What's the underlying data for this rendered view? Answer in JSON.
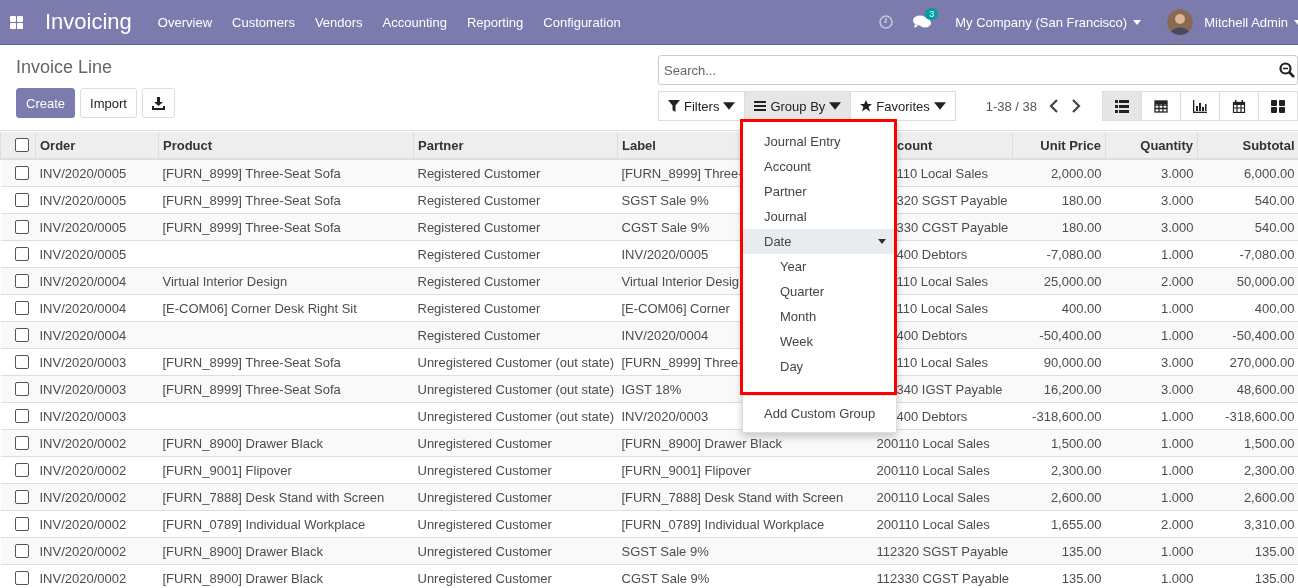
{
  "navbar": {
    "app_title": "Invoicing",
    "menu": [
      "Overview",
      "Customers",
      "Vendors",
      "Accounting",
      "Reporting",
      "Configuration"
    ],
    "messages_badge": "3",
    "company": "My Company (San Francisco)",
    "user": "Mitchell Admin"
  },
  "control_panel": {
    "title": "Invoice Line",
    "buttons": [
      "Create",
      "Import"
    ],
    "search": {
      "placeholder": "Search..."
    },
    "search_buttons": [
      {
        "label": "Filters",
        "kind": "filter",
        "selected": false
      },
      {
        "label": "Group By",
        "kind": "group",
        "selected": true
      },
      {
        "label": "Favorites",
        "kind": "star",
        "selected": false
      }
    ],
    "pager": "1-38 / 38",
    "views": [
      {
        "kind": "list",
        "selected": true
      },
      {
        "kind": "pivot",
        "selected": false
      },
      {
        "kind": "graph",
        "selected": false
      },
      {
        "kind": "calendar",
        "selected": false
      },
      {
        "kind": "kanban",
        "selected": false
      }
    ]
  },
  "group_by_menu": {
    "options": [
      {
        "label": "Journal Entry"
      },
      {
        "label": "Account"
      },
      {
        "label": "Partner"
      },
      {
        "label": "Journal"
      },
      {
        "label": "Date",
        "expanded": true,
        "children": [
          {
            "label": "Year"
          },
          {
            "label": "Quarter"
          },
          {
            "label": "Month"
          },
          {
            "label": "Week"
          },
          {
            "label": "Day"
          }
        ]
      }
    ],
    "custom": "Add Custom Group"
  },
  "table": {
    "all_checked": false,
    "columns": [
      "Order",
      "Product",
      "Partner",
      "Label",
      "count",
      "Unit Price",
      "Quantity",
      "Subtotal"
    ],
    "rows": [
      {
        "checked": false,
        "under_menu": true,
        "cells": [
          "INV/2020/0005",
          "[FURN_8999] Three-Seat Sofa",
          "Registered Customer",
          "[FURN_8999] Three-",
          "110 Local Sales",
          "2,000.00",
          "3.000",
          "6,000.00"
        ]
      },
      {
        "checked": false,
        "under_menu": true,
        "cells": [
          "INV/2020/0005",
          "[FURN_8999] Three-Seat Sofa",
          "Registered Customer",
          "SGST Sale 9%",
          "320 SGST Payable",
          "180.00",
          "3.000",
          "540.00"
        ]
      },
      {
        "checked": false,
        "under_menu": true,
        "cells": [
          "INV/2020/0005",
          "[FURN_8999] Three-Seat Sofa",
          "Registered Customer",
          "CGST Sale 9%",
          "330 CGST Payable",
          "180.00",
          "3.000",
          "540.00"
        ]
      },
      {
        "checked": false,
        "under_menu": true,
        "cells": [
          "INV/2020/0005",
          "",
          "Registered Customer",
          "INV/2020/0005",
          "400 Debtors",
          "-7,080.00",
          "1.000",
          "-7,080.00"
        ]
      },
      {
        "checked": false,
        "under_menu": true,
        "cells": [
          "INV/2020/0004",
          "Virtual Interior Design",
          "Registered Customer",
          "Virtual Interior Desig",
          "110 Local Sales",
          "25,000.00",
          "2.000",
          "50,000.00"
        ]
      },
      {
        "checked": false,
        "under_menu": true,
        "cells": [
          "INV/2020/0004",
          "[E-COM06] Corner Desk Right Sit",
          "Registered Customer",
          "[E-COM06] Corner",
          "110 Local Sales",
          "400.00",
          "1.000",
          "400.00"
        ]
      },
      {
        "checked": false,
        "under_menu": true,
        "cells": [
          "INV/2020/0004",
          "",
          "Registered Customer",
          "INV/2020/0004",
          "400 Debtors",
          "-50,400.00",
          "1.000",
          "-50,400.00"
        ]
      },
      {
        "checked": false,
        "under_menu": true,
        "cells": [
          "INV/2020/0003",
          "[FURN_8999] Three-Seat Sofa",
          "Unregistered Customer (out state)",
          "[FURN_8999] Three-",
          "110 Local Sales",
          "90,000.00",
          "3.000",
          "270,000.00"
        ]
      },
      {
        "checked": false,
        "under_menu": true,
        "cells": [
          "INV/2020/0003",
          "[FURN_8999] Three-Seat Sofa",
          "Unregistered Customer (out state)",
          "IGST 18%",
          "340 IGST Payable",
          "16,200.00",
          "3.000",
          "48,600.00"
        ]
      },
      {
        "checked": false,
        "under_menu": true,
        "cells": [
          "INV/2020/0003",
          "",
          "Unregistered Customer (out state)",
          "INV/2020/0003",
          "400 Debtors",
          "-318,600.00",
          "1.000",
          "-318,600.00"
        ]
      },
      {
        "checked": false,
        "under_menu": false,
        "cells": [
          "INV/2020/0002",
          "[FURN_8900] Drawer Black",
          "Unregistered Customer",
          "[FURN_8900] Drawer Black",
          "200110 Local Sales",
          "1,500.00",
          "1.000",
          "1,500.00"
        ]
      },
      {
        "checked": false,
        "under_menu": false,
        "cells": [
          "INV/2020/0002",
          "[FURN_9001] Flipover",
          "Unregistered Customer",
          "[FURN_9001] Flipover",
          "200110 Local Sales",
          "2,300.00",
          "1.000",
          "2,300.00"
        ]
      },
      {
        "checked": false,
        "under_menu": false,
        "cells": [
          "INV/2020/0002",
          "[FURN_7888] Desk Stand with Screen",
          "Unregistered Customer",
          "[FURN_7888] Desk Stand with Screen",
          "200110 Local Sales",
          "2,600.00",
          "1.000",
          "2,600.00"
        ]
      },
      {
        "checked": false,
        "under_menu": false,
        "cells": [
          "INV/2020/0002",
          "[FURN_0789] Individual Workplace",
          "Unregistered Customer",
          "[FURN_0789] Individual Workplace",
          "200110 Local Sales",
          "1,655.00",
          "2.000",
          "3,310.00"
        ]
      },
      {
        "checked": false,
        "under_menu": false,
        "cells": [
          "INV/2020/0002",
          "[FURN_8900] Drawer Black",
          "Unregistered Customer",
          "SGST Sale 9%",
          "112320 SGST Payable",
          "135.00",
          "1.000",
          "135.00"
        ]
      },
      {
        "checked": false,
        "under_menu": false,
        "cells": [
          "INV/2020/0002",
          "[FURN_8900] Drawer Black",
          "Unregistered Customer",
          "CGST Sale 9%",
          "112330 CGST Payable",
          "135.00",
          "1.000",
          "135.00"
        ]
      }
    ]
  }
}
